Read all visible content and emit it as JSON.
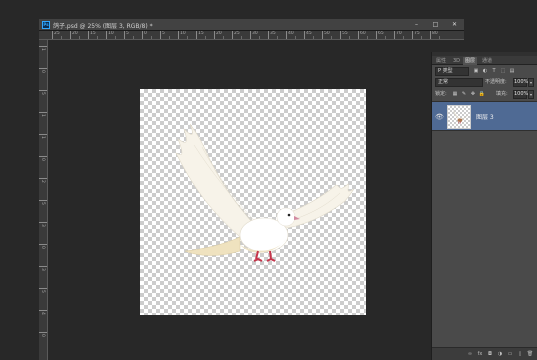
{
  "document": {
    "ps_logo": "Ps",
    "title": "鸽子.psd @ 25% (图层 3, RGB/8) *",
    "window_buttons": [
      "–",
      "□",
      "✕"
    ],
    "ruler_h_labels": [
      "25",
      "20",
      "15",
      "10",
      "5",
      "0",
      "5",
      "10",
      "15",
      "20",
      "25",
      "30",
      "35",
      "40",
      "45",
      "50",
      "55",
      "60",
      "65",
      "70",
      "75",
      "80"
    ],
    "ruler_v_labels": [
      "1",
      "0",
      "5",
      "1",
      "1",
      "0",
      "2",
      "5",
      "3",
      "0",
      "3",
      "5",
      "4",
      "0"
    ]
  },
  "layers_panel": {
    "tabs": [
      "属性",
      "3D",
      "图层",
      "通道"
    ],
    "active_tab": 2,
    "kind_filter": "P 类型",
    "filter_icons": [
      "▣",
      "◐",
      "T",
      "⬚",
      "▤"
    ],
    "blend_mode": "正常",
    "opacity_label": "不透明度:",
    "opacity_value": "100%",
    "lock_label": "锁定:",
    "lock_icons": [
      "▦",
      "✎",
      "✥",
      "🔒"
    ],
    "fill_label": "填充:",
    "fill_value": "100%",
    "layer": {
      "name": "图层 3",
      "visible_icon": "👁"
    },
    "bottom_icons": [
      "∞",
      "fx",
      "◘",
      "◑",
      "▭",
      "▯",
      "🗑"
    ]
  },
  "colors": {
    "workspace": "#282828",
    "panel": "#4a4a4a",
    "selected_layer": "#4f6a94",
    "accent": "#31a8ff"
  }
}
